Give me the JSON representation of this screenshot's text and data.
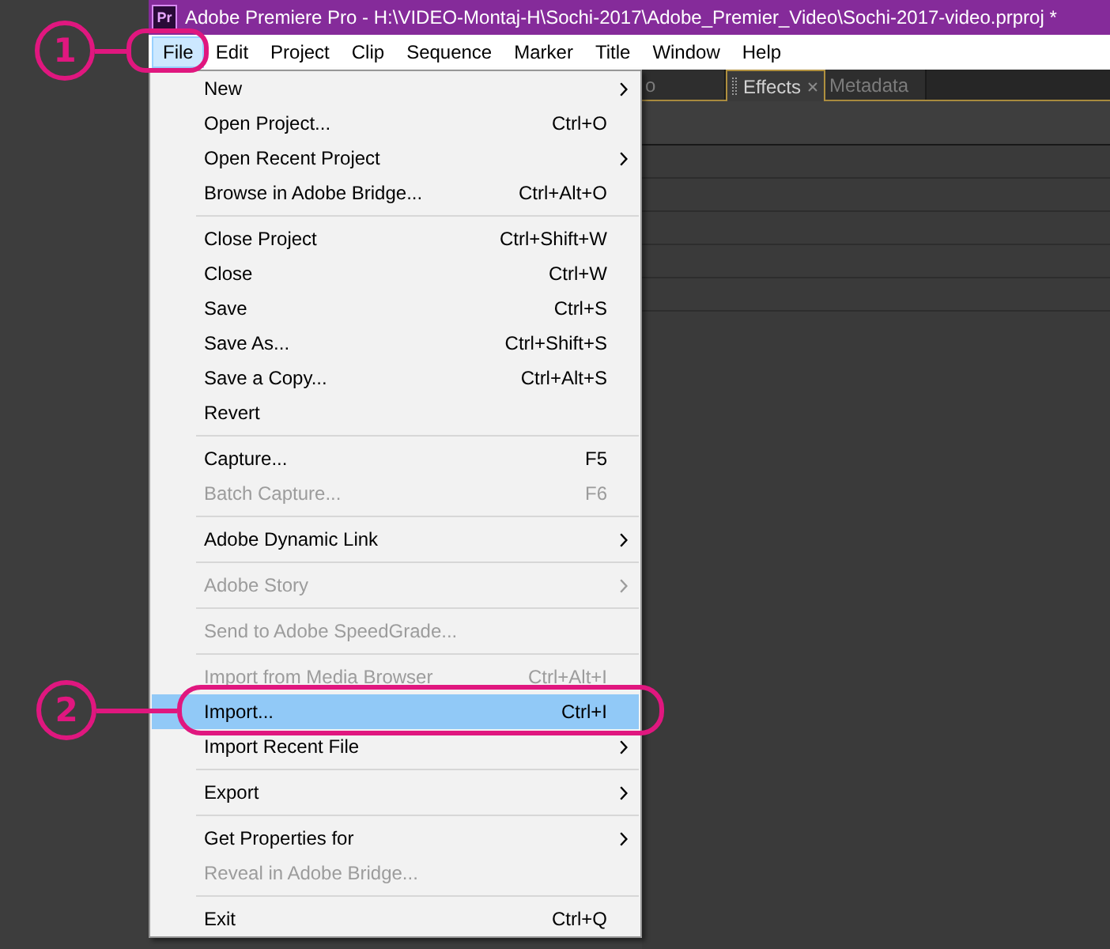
{
  "window": {
    "app_icon": "Pr",
    "title": "Adobe Premiere Pro - H:\\VIDEO-Montaj-H\\Sochi-2017\\Adobe_Premier_Video\\Sochi-2017-video.prproj *"
  },
  "menu_bar": [
    {
      "label": "File",
      "selected": true
    },
    {
      "label": "Edit",
      "selected": false
    },
    {
      "label": "Project",
      "selected": false
    },
    {
      "label": "Clip",
      "selected": false
    },
    {
      "label": "Sequence",
      "selected": false
    },
    {
      "label": "Marker",
      "selected": false
    },
    {
      "label": "Title",
      "selected": false
    },
    {
      "label": "Window",
      "selected": false
    },
    {
      "label": "Help",
      "selected": false
    }
  ],
  "file_menu": {
    "groups": [
      [
        {
          "label": "New",
          "submenu": true,
          "disabled": false,
          "selected": false
        },
        {
          "label": "Open Project...",
          "shortcut": "Ctrl+O",
          "submenu": false,
          "disabled": false,
          "selected": false
        },
        {
          "label": "Open Recent Project",
          "submenu": true,
          "disabled": false,
          "selected": false
        },
        {
          "label": "Browse in Adobe Bridge...",
          "shortcut": "Ctrl+Alt+O",
          "submenu": false,
          "disabled": false,
          "selected": false
        }
      ],
      [
        {
          "label": "Close Project",
          "shortcut": "Ctrl+Shift+W",
          "submenu": false,
          "disabled": false,
          "selected": false
        },
        {
          "label": "Close",
          "shortcut": "Ctrl+W",
          "submenu": false,
          "disabled": false,
          "selected": false
        },
        {
          "label": "Save",
          "shortcut": "Ctrl+S",
          "submenu": false,
          "disabled": false,
          "selected": false
        },
        {
          "label": "Save As...",
          "shortcut": "Ctrl+Shift+S",
          "submenu": false,
          "disabled": false,
          "selected": false
        },
        {
          "label": "Save a Copy...",
          "shortcut": "Ctrl+Alt+S",
          "submenu": false,
          "disabled": false,
          "selected": false
        },
        {
          "label": "Revert",
          "submenu": false,
          "disabled": false,
          "selected": false
        }
      ],
      [
        {
          "label": "Capture...",
          "shortcut": "F5",
          "submenu": false,
          "disabled": false,
          "selected": false
        },
        {
          "label": "Batch Capture...",
          "shortcut": "F6",
          "submenu": false,
          "disabled": true,
          "selected": false
        }
      ],
      [
        {
          "label": "Adobe Dynamic Link",
          "submenu": true,
          "disabled": false,
          "selected": false
        }
      ],
      [
        {
          "label": "Adobe Story",
          "submenu": true,
          "disabled": true,
          "selected": false
        }
      ],
      [
        {
          "label": "Send to Adobe SpeedGrade...",
          "submenu": false,
          "disabled": true,
          "selected": false
        }
      ],
      [
        {
          "label": "Import from Media Browser",
          "shortcut": "Ctrl+Alt+I",
          "submenu": false,
          "disabled": true,
          "selected": false
        },
        {
          "label": "Import...",
          "shortcut": "Ctrl+I",
          "submenu": false,
          "disabled": false,
          "selected": true
        },
        {
          "label": "Import Recent File",
          "submenu": true,
          "disabled": false,
          "selected": false
        }
      ],
      [
        {
          "label": "Export",
          "submenu": true,
          "disabled": false,
          "selected": false
        }
      ],
      [
        {
          "label": "Get Properties for",
          "submenu": true,
          "disabled": false,
          "selected": false
        },
        {
          "label": "Reveal in Adobe Bridge...",
          "submenu": false,
          "disabled": true,
          "selected": false
        }
      ],
      [
        {
          "label": "Exit",
          "shortcut": "Ctrl+Q",
          "submenu": false,
          "disabled": false,
          "selected": false
        }
      ]
    ]
  },
  "panel": {
    "tabs": [
      {
        "label": "o",
        "selected": false,
        "closable": false
      },
      {
        "label": "Effects",
        "selected": true,
        "closable": true
      },
      {
        "label": "Metadata",
        "selected": false,
        "closable": false
      }
    ]
  },
  "annotations": [
    {
      "number": "1"
    },
    {
      "number": "2"
    }
  ]
}
